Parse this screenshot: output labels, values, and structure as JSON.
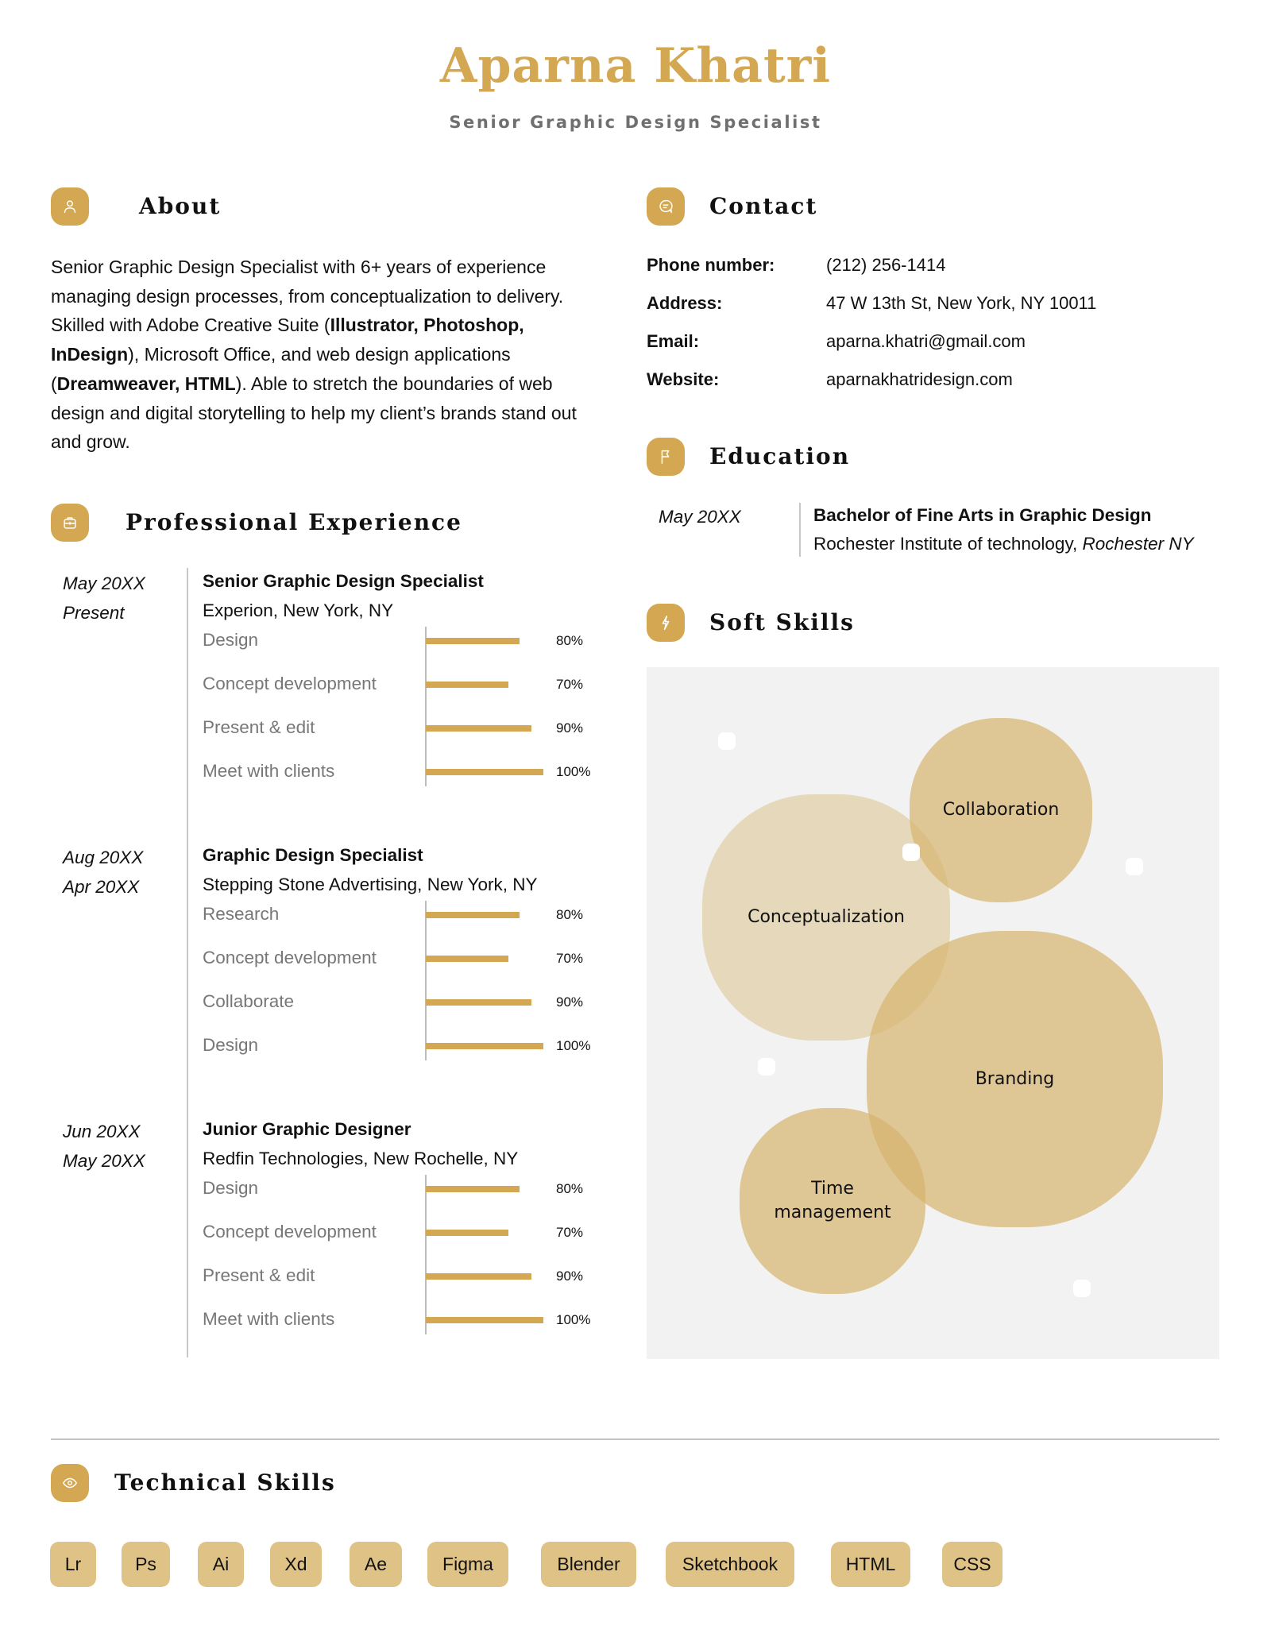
{
  "header": {
    "name": "Aparna Khatri",
    "title": "Senior Graphic Design Specialist"
  },
  "colors": {
    "accent": "#D4A853",
    "chip": "#DFC386",
    "panel": "#F2F2F2",
    "muted_text": "#777777"
  },
  "about": {
    "heading": "About",
    "icon": "user-icon",
    "segments": [
      {
        "text": "Senior Graphic Design Specialist with 6+ years of experience managing design processes, from conceptualization to delivery. Skilled with Adobe Creative Suite (",
        "bold": false
      },
      {
        "text": "Illustrator, Photoshop, InDesign",
        "bold": true
      },
      {
        "text": "), Microsoft Office, and web design applications (",
        "bold": false
      },
      {
        "text": "Dreamweaver, HTML",
        "bold": true
      },
      {
        "text": "). Able to stretch the boundaries of web design and digital storytelling to help my client’s brands stand out and grow.",
        "bold": false
      }
    ]
  },
  "contact": {
    "heading": "Contact",
    "icon": "chat-icon",
    "rows": [
      {
        "label": "Phone number:",
        "value": "(212) 256-1414"
      },
      {
        "label": "Address:",
        "value": "47 W 13th St, New York, NY 10011"
      },
      {
        "label": "Email:",
        "value": "aparna.khatri@gmail.com"
      },
      {
        "label": "Website:",
        "value": "aparnakhatridesign.com"
      }
    ]
  },
  "education": {
    "heading": "Education",
    "icon": "flag-icon",
    "items": [
      {
        "date": "May 20XX",
        "degree": "Bachelor of Fine Arts in Graphic Design",
        "school": "Rochester Institute of technology,",
        "location": "Rochester NY"
      }
    ]
  },
  "experience": {
    "heading": "Professional Experience",
    "icon": "briefcase-icon",
    "jobs": [
      {
        "start": "May 20XX",
        "end": "Present",
        "title": "Senior Graphic Design Specialist",
        "company": "Experion, New York, NY",
        "skills": [
          {
            "label": "Design",
            "value": 80,
            "display": "80%"
          },
          {
            "label": "Concept development",
            "value": 70,
            "display": "70%"
          },
          {
            "label": "Present & edit",
            "value": 90,
            "display": "90%"
          },
          {
            "label": "Meet with clients",
            "value": 100,
            "display": "100%"
          }
        ]
      },
      {
        "start": "Aug 20XX",
        "end": "Apr 20XX",
        "title": "Graphic Design Specialist",
        "company": "Stepping Stone Advertising, New York, NY",
        "skills": [
          {
            "label": "Research",
            "value": 80,
            "display": "80%"
          },
          {
            "label": "Concept development",
            "value": 70,
            "display": "70%"
          },
          {
            "label": "Collaborate",
            "value": 90,
            "display": "90%"
          },
          {
            "label": "Design",
            "value": 100,
            "display": "100%"
          }
        ]
      },
      {
        "start": "Jun 20XX",
        "end": "May 20XX",
        "title": "Junior Graphic Designer",
        "company": "Redfin Technologies, New Rochelle, NY",
        "skills": [
          {
            "label": "Design",
            "value": 80,
            "display": "80%"
          },
          {
            "label": "Concept development",
            "value": 70,
            "display": "70%"
          },
          {
            "label": "Present & edit",
            "value": 90,
            "display": "90%"
          },
          {
            "label": "Meet with clients",
            "value": 100,
            "display": "100%"
          }
        ]
      }
    ]
  },
  "soft_skills": {
    "heading": "Soft Skills",
    "icon": "lightning-icon",
    "bubbles": [
      {
        "label": "Conceptualization",
        "tone": "light"
      },
      {
        "label": "Collaboration",
        "tone": "medium"
      },
      {
        "label": "Branding",
        "tone": "medium"
      },
      {
        "label": "Time management",
        "tone": "medium"
      }
    ]
  },
  "technical_skills": {
    "heading": "Technical Skills",
    "icon": "eye-icon",
    "chips": [
      "Lr",
      "Ps",
      "Ai",
      "Xd",
      "Ae",
      "Figma",
      "Blender",
      "Sketchbook",
      "HTML",
      "CSS"
    ]
  }
}
